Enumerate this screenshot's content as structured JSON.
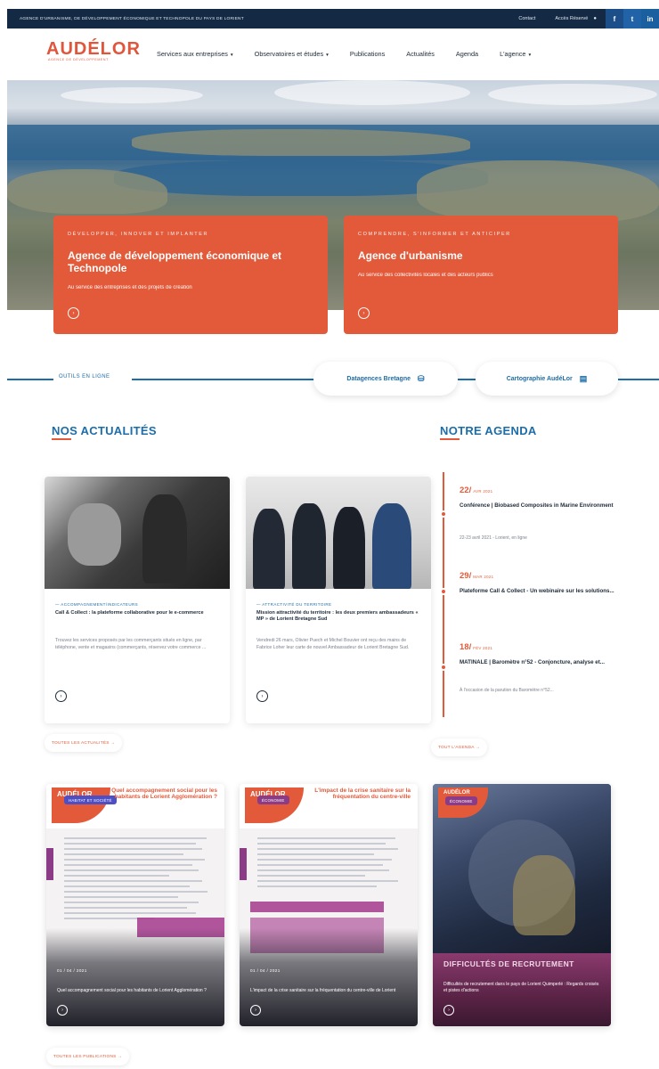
{
  "topbar": {
    "tagline": "AGENCE D'URBANISME, DE DÉVELOPPEMENT ÉCONOMIQUE ET TECHNOPOLE DU PAYS DE LORIENT",
    "contact": "Contact",
    "access": "Accès Réservé"
  },
  "header": {
    "logo": "AUDÉLOR",
    "logo_sub": "AGENCE DE DÉVELOPPEMENT",
    "nav": [
      {
        "label": "Services aux entreprises",
        "caret": true
      },
      {
        "label": "Observatoires et études",
        "caret": true
      },
      {
        "label": "Publications",
        "caret": false
      },
      {
        "label": "Actualités",
        "caret": false
      },
      {
        "label": "Agenda",
        "caret": false
      },
      {
        "label": "L'agence",
        "caret": true
      }
    ]
  },
  "hero": {
    "cards": [
      {
        "kicker": "DÉVELOPPER, INNOVER ET IMPLANTER",
        "title": "Agence de développement économique et Technopole",
        "desc": "Au service des entreprises et des projets de création"
      },
      {
        "kicker": "COMPRENDRE, S'INFORMER ET ANTICIPER",
        "title": "Agence d'urbanisme",
        "desc": "Au service des collectivités locales et des acteurs publics"
      }
    ]
  },
  "tools": {
    "label": "OUTILS EN LIGNE",
    "items": [
      "Datagences Bretagne",
      "Cartographie AudéLor"
    ]
  },
  "news": {
    "title": "NOS ACTUALITÉS",
    "items": [
      {
        "category": "— ACCOMPAGNEMENT/INDICATEURS",
        "title": "Call & Collect : la plateforme collaborative pour le e-commerce",
        "desc": "Trouvez les services proposés par les commerçants situés en ligne, par téléphone, vente et magasins (commerçants, réservez votre commerce ..."
      },
      {
        "category": "— ATTRACTIVITÉ DU TERRITOIRE",
        "title": "Mission attractivité du territoire : les deux premiers ambassadeurs « MP » de Lorient Bretagne Sud",
        "desc": "Vendredi 26 mars, Olivier Puech et Michel Bouvier ont reçu des mains de Fabrice Loher leur carte de nouvel Ambassadeur de Lorient Bretagne Sud."
      }
    ],
    "more": "TOUTES LES ACTUALITÉS →"
  },
  "agenda": {
    "title": "NOTRE AGENDA",
    "items": [
      {
        "day": "22/",
        "month": "AVR 2021",
        "title": "Conférence | Biobased Composites in Marine Environment",
        "meta": "22-23 avril 2021 - Lorient, en ligne"
      },
      {
        "day": "29/",
        "month": "MAR 2021",
        "title": "Plateforme Call & Collect - Un webinaire sur les solutions...",
        "meta": ""
      },
      {
        "day": "18/",
        "month": "FÉV 2021",
        "title": "MATINALE | Baromètre n°52 - Conjoncture, analyse et...",
        "meta": "À l'occasion de la parution du Baromètre n°52..."
      }
    ],
    "more": "TOUT L'AGENDA →"
  },
  "publications": {
    "items": [
      {
        "doc_title": "Quel accompagnement social pour les habitants de Lorient Agglomération ?",
        "badge": "HABITAT ET SOCIÉTÉ",
        "date": "01 / 04 / 2021",
        "title": "Quel accompagnement social pour les habitants de Lorient Agglomération ?"
      },
      {
        "doc_title": "L'impact de la crise sanitaire sur la fréquentation du centre-ville",
        "badge": "ÉCONOMIE",
        "date": "01 / 04 / 2021",
        "title": "L'impact de la crise sanitaire sur la fréquentation du centre-ville de Lorient"
      },
      {
        "doc_title": "",
        "badge": "ÉCONOMIE",
        "date": "",
        "title_big": "DIFFICULTÉS DE RECRUTEMENT",
        "title": "Difficultés de recrutement dans le pays de Lorient Quimperlé : Regards croisés et pistes d'actions"
      }
    ],
    "more": "TOUTES LES PUBLICATIONS →"
  },
  "colors": {
    "accent": "#e35a3a",
    "primary": "#1c6da8",
    "navy": "#142a44"
  }
}
